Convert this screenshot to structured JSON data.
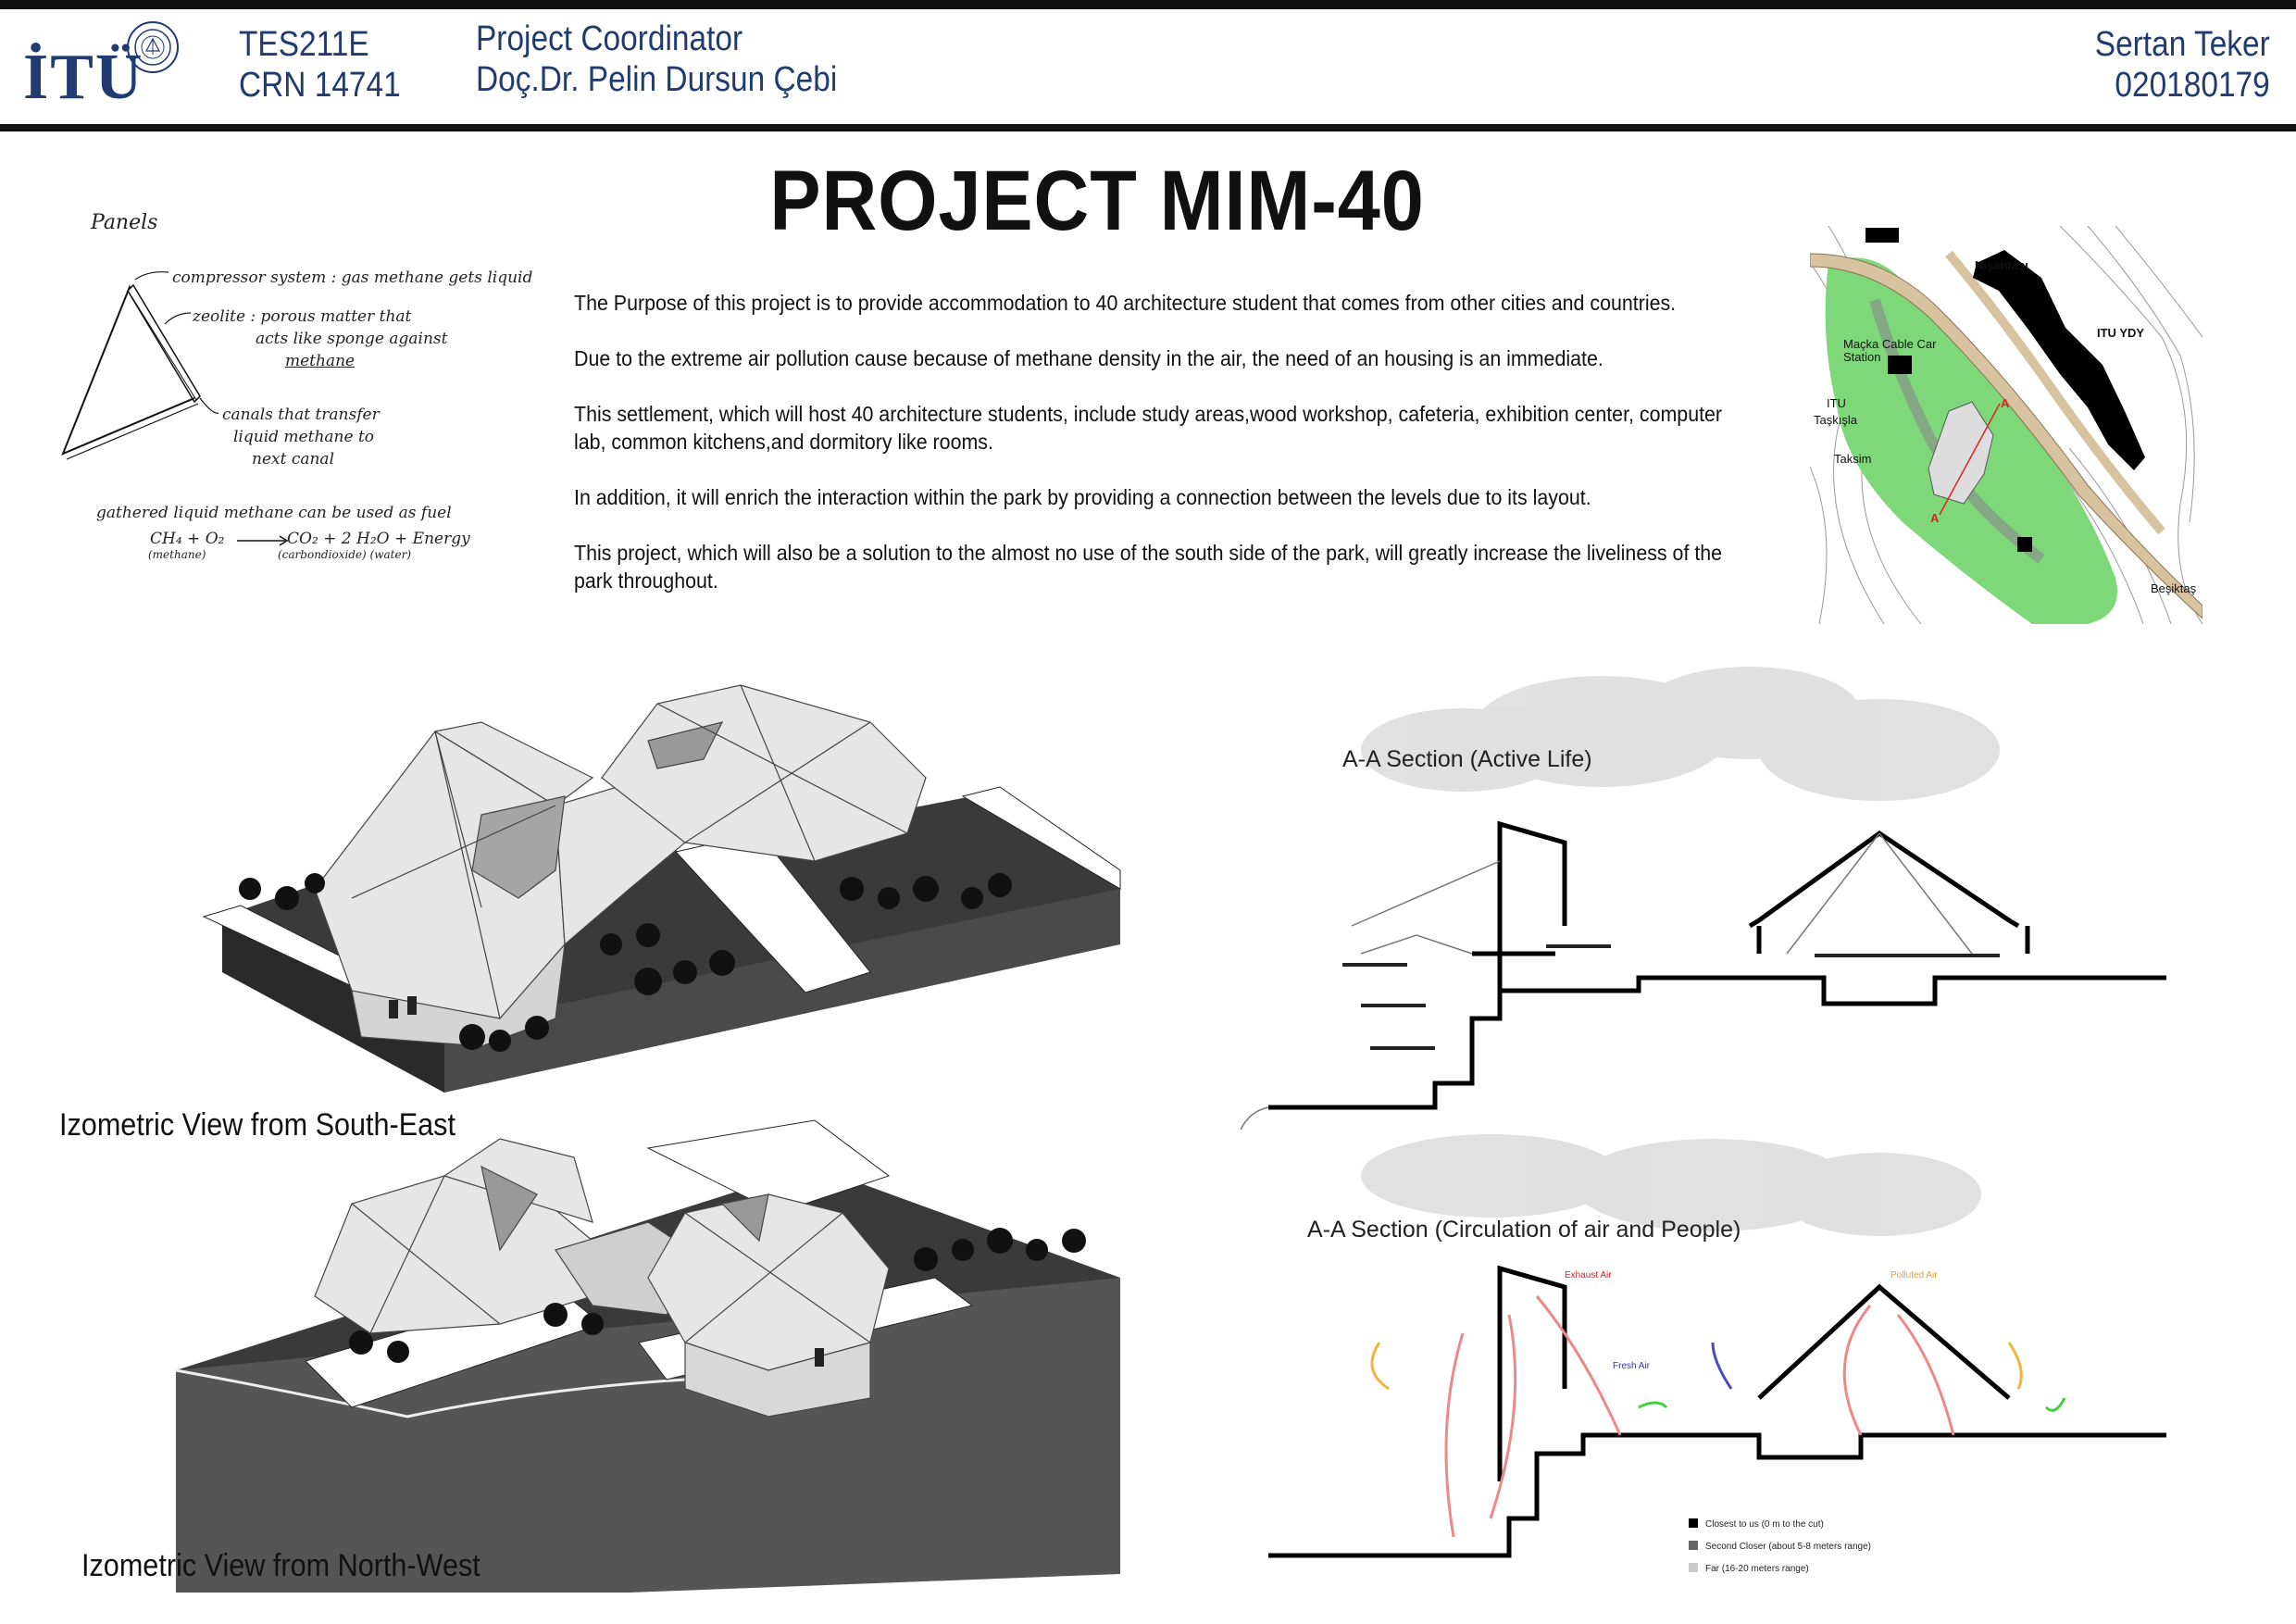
{
  "header": {
    "logo_text": "İTÜ",
    "course_code": "TES211E",
    "crn": "CRN 14741",
    "coordinator_label": "Project Coordinator",
    "coordinator_name": "Doç.Dr. Pelin Dursun Çebi",
    "student_name": "Sertan Teker",
    "student_id": "020180179"
  },
  "title": "PROJECT MIM-40",
  "description": [
    "The Purpose of this project is to provide accommodation to 40 architecture student that comes from other cities and countries.",
    "Due to the extreme air pollution cause because of methane density in the air, the need of an housing is an immediate.",
    "This settlement, which will host 40 architecture students, include study areas,wood workshop, cafeteria, exhibition center, computer lab, common kitchens,and dormitory like rooms.",
    "In addition, it will enrich the interaction within the park by providing a connection between the levels due to its layout.",
    "This project, which will also be a solution to the almost no use of the south side of the park, will greatly increase the liveliness of the park throughout."
  ],
  "notes": {
    "heading": "Panels",
    "compressor": "compressor system : gas methane gets liquid",
    "zeolite": [
      "zeolite : porous matter that",
      "acts like sponge against",
      "methane"
    ],
    "canals": [
      "canals that transfer",
      "liquid methane to",
      "next canal"
    ],
    "gathered": "gathered liquid methane can be used as fuel",
    "eq_left": "CH₄  +  O₂",
    "eq_right": "CO₂  +  2 H₂O + Energy",
    "eq_sub_left": "(methane)",
    "eq_sub_right": "(carbondioxide)   (water)"
  },
  "map": {
    "labels": {
      "nisantasi": "Nişantaşı",
      "itu_ydy": "ITU YDY",
      "macka": "Maçka Cable Car",
      "station": "Station",
      "itu": "ITU",
      "taskisla": "Taşkışla",
      "taksim": "Taksim",
      "besiktas": "Beşiktaş",
      "section_marker": "A"
    },
    "colors": {
      "park": "#7ed87a",
      "road": "#d8c3a0",
      "building": "#000000"
    }
  },
  "views": {
    "south_east": "Izometric View from South-East",
    "north_west": "Izometric View from North-West"
  },
  "sections": {
    "active_life": "A-A Section (Active Life)",
    "circulation": "A-A Section (Circulation of air and People)",
    "exhaust_air": "Exhaust Air",
    "fresh_air": "Fresh Air",
    "polluted_air": "Polluted Air",
    "legend": [
      {
        "label": "Closest to us  (0 m to the cut)",
        "color": "#000000"
      },
      {
        "label": "Second Closer (about 5-8 meters range)",
        "color": "#666666"
      },
      {
        "label": "Far (16-20 meters range)",
        "color": "#cccccc"
      }
    ]
  }
}
